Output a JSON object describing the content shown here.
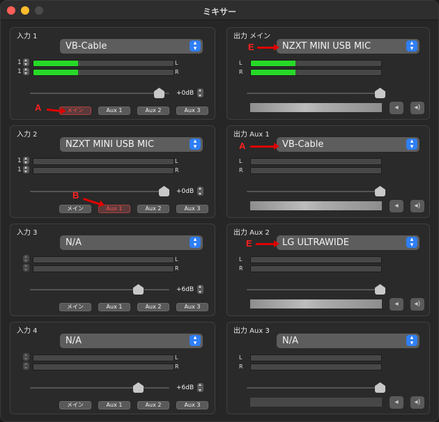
{
  "window": {
    "title": "ミキサー"
  },
  "inputs": [
    {
      "label": "入力 1",
      "device": "VB-Cable",
      "ch1": "1",
      "ch2": "1",
      "L": "L",
      "R": "R",
      "meter_l": 0.32,
      "meter_r": 0.32,
      "gain": "+0dB",
      "buttons": [
        "メイン",
        "Aux 1",
        "Aux 2",
        "Aux 3"
      ],
      "active_button": 0,
      "annotation": "A"
    },
    {
      "label": "入力 2",
      "device": "NZXT MINI USB MIC",
      "ch1": "1",
      "ch2": "1",
      "L": "L",
      "R": "R",
      "meter_l": 0,
      "meter_r": 0,
      "gain": "+0dB",
      "buttons": [
        "メイン",
        "Aux 1",
        "Aux 2",
        "Aux 3"
      ],
      "active_button": 1,
      "annotation": "B"
    },
    {
      "label": "入力 3",
      "device": "N/A",
      "ch1": "",
      "ch2": "",
      "L": "L",
      "R": "R",
      "meter_l": 0,
      "meter_r": 0,
      "gain": "+6dB",
      "buttons": [
        "メイン",
        "Aux 1",
        "Aux 2",
        "Aux 3"
      ],
      "active_button": -1,
      "annotation": ""
    },
    {
      "label": "入力 4",
      "device": "N/A",
      "ch1": "",
      "ch2": "",
      "L": "L",
      "R": "R",
      "meter_l": 0,
      "meter_r": 0,
      "gain": "+6dB",
      "buttons": [
        "メイン",
        "Aux 1",
        "Aux 2",
        "Aux 3"
      ],
      "active_button": -1,
      "annotation": ""
    }
  ],
  "outputs": [
    {
      "label": "出力 メイン",
      "device": "NZXT MINI USB MIC",
      "L": "L",
      "R": "R",
      "meter_l": 0.34,
      "meter_r": 0.34,
      "annotation": "E"
    },
    {
      "label": "出力 Aux 1",
      "device": "VB-Cable",
      "L": "L",
      "R": "R",
      "meter_l": 0,
      "meter_r": 0,
      "annotation": "A"
    },
    {
      "label": "出力 Aux 2",
      "device": "LG ULTRAWIDE",
      "L": "L",
      "R": "R",
      "meter_l": 0,
      "meter_r": 0,
      "annotation": "E"
    },
    {
      "label": "出力 Aux 3",
      "device": "N/A",
      "L": "L",
      "R": "R",
      "meter_l": 0,
      "meter_r": 0,
      "annotation": ""
    }
  ],
  "icons": {
    "mute": "speaker-mute-icon",
    "volume": "speaker-volume-icon",
    "dropdown": "chevron-updown-icon"
  },
  "colors": {
    "meter_green": "#27d927",
    "accent_blue": "#2f7ff5",
    "annotation_red": "#e00000"
  }
}
